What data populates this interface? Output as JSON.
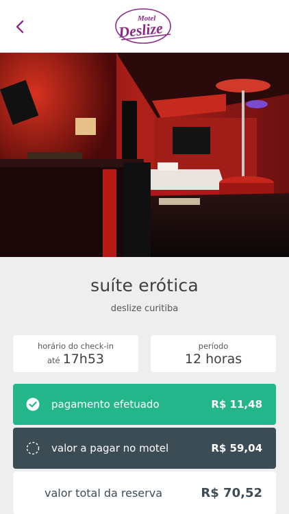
{
  "header": {
    "back_icon": "chevron-left-icon",
    "logo_text_top": "Motel",
    "logo_text_main": "Deslize",
    "accent": "#8a2b87"
  },
  "hero": {
    "image": "suite-room-photo"
  },
  "suite": {
    "name": "suíte erótica",
    "location": "deslize curitiba"
  },
  "checkin": {
    "label": "horário do check-in",
    "prefix": "até",
    "time": "17h53"
  },
  "period": {
    "label": "período",
    "value": "12 horas"
  },
  "payment": {
    "paid_label": "pagamento efetuado",
    "paid_amount": "R$ 11,48",
    "paid_icon": "check-circle-icon",
    "paid_color": "#23b68b",
    "due_label": "valor a pagar no motel",
    "due_amount": "R$ 59,04",
    "due_icon": "dashed-circle-icon",
    "due_color": "#3c4c55",
    "total_label": "valor total da reserva",
    "total_amount": "R$ 70,52"
  }
}
